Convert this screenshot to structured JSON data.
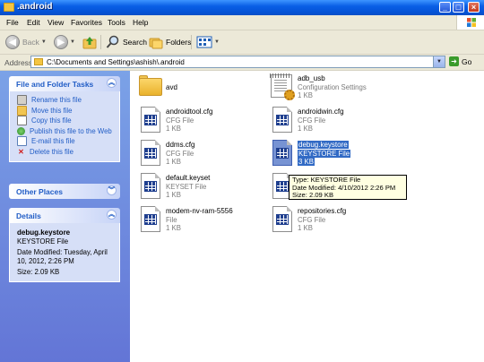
{
  "window": {
    "title": ".android"
  },
  "menu": [
    "File",
    "Edit",
    "View",
    "Favorites",
    "Tools",
    "Help"
  ],
  "toolbar": {
    "back": "Back",
    "search": "Search",
    "folders": "Folders"
  },
  "address": {
    "label": "Address",
    "path": "C:\\Documents and Settings\\ashish\\.android",
    "go": "Go"
  },
  "tasks_panel": {
    "title": "File and Folder Tasks",
    "items": [
      {
        "label": "Rename this file",
        "icon": "rename-icon"
      },
      {
        "label": "Move this file",
        "icon": "move-icon"
      },
      {
        "label": "Copy this file",
        "icon": "copy-icon"
      },
      {
        "label": "Publish this file to the Web",
        "icon": "publish-icon"
      },
      {
        "label": "E-mail this file",
        "icon": "email-icon"
      },
      {
        "label": "Delete this file",
        "icon": "delete-icon"
      }
    ]
  },
  "other_places": {
    "title": "Other Places"
  },
  "details": {
    "title": "Details",
    "name": "debug.keystore",
    "type": "KEYSTORE File",
    "modified_1": "Date Modified: Tuesday, April",
    "modified_2": "10, 2012, 2:26 PM",
    "size": "Size: 2.09 KB"
  },
  "files": [
    {
      "name": "avd",
      "type": "",
      "size": "",
      "icon": "folder-icon"
    },
    {
      "name": "adb_usb",
      "type": "Configuration Settings",
      "size": "1 KB",
      "icon": "config-icon"
    },
    {
      "name": "androidtool.cfg",
      "type": "CFG File",
      "size": "1 KB",
      "icon": "file-icon"
    },
    {
      "name": "androidwin.cfg",
      "type": "CFG File",
      "size": "1 KB",
      "icon": "file-icon"
    },
    {
      "name": "ddms.cfg",
      "type": "CFG File",
      "size": "1 KB",
      "icon": "file-icon"
    },
    {
      "name": "debug.keystore",
      "type": "KEYSTORE File",
      "size": "3 KB",
      "icon": "file-icon",
      "selected": true
    },
    {
      "name": "default.keyset",
      "type": "KEYSET File",
      "size": "1 KB",
      "icon": "file-icon"
    },
    {
      "name": "",
      "type": "",
      "size": "",
      "icon": "file-icon"
    },
    {
      "name": "modem-nv-ram-5556",
      "type": "File",
      "size": "1 KB",
      "icon": "file-icon"
    },
    {
      "name": "repositories.cfg",
      "type": "CFG File",
      "size": "1 KB",
      "icon": "file-icon"
    }
  ],
  "tooltip": {
    "type": "Type: KEYSTORE File",
    "date": "Date Modified: 4/10/2012 2:26 PM",
    "size": "Size: 2.09 KB"
  }
}
